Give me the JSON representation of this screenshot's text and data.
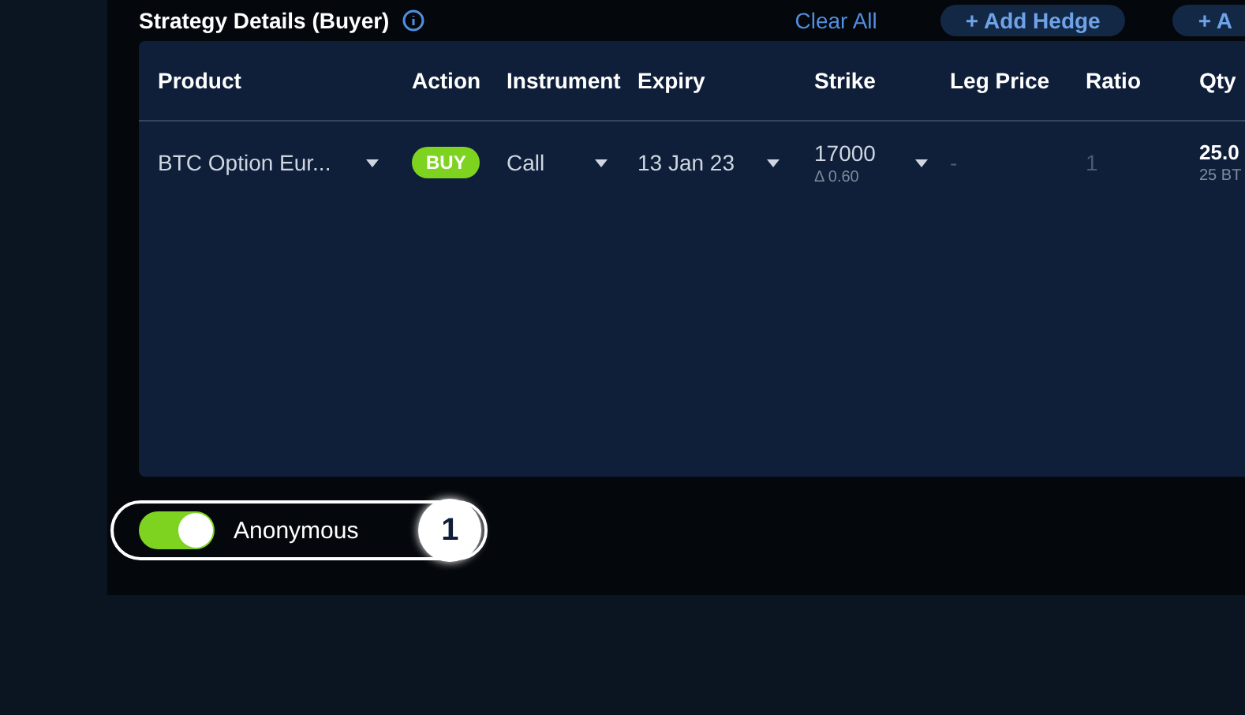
{
  "section": {
    "title": "Strategy Details (Buyer)",
    "clear_label": "Clear All",
    "buttons": [
      {
        "icon": "+",
        "label": "Add Hedge"
      },
      {
        "icon": "+",
        "label": "A"
      }
    ]
  },
  "table": {
    "columns": [
      "Product",
      "Action",
      "Instrument",
      "Expiry",
      "Strike",
      "Leg Price",
      "Ratio",
      "Qty"
    ],
    "rows": [
      {
        "product": "BTC Option Eur...",
        "action": "BUY",
        "instrument": "Call",
        "expiry": "13 Jan 23",
        "strike": "17000",
        "delta": "Δ 0.60",
        "leg_price": "-",
        "ratio": "1",
        "qty": "25.0",
        "qty_unit": "25 BT"
      }
    ]
  },
  "anonymous": {
    "label": "Anonymous",
    "on": true,
    "step": "1"
  }
}
